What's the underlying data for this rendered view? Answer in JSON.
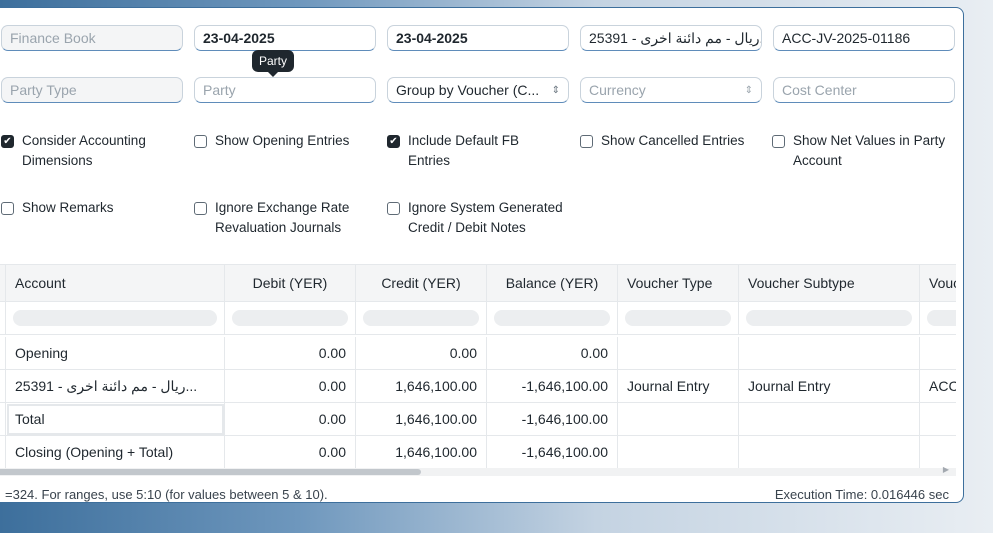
{
  "filters": {
    "finance_book": "Finance Book",
    "from_date": "23-04-2025",
    "to_date": "23-04-2025",
    "account": "25391 - ريال - مم دائنة اخرى...",
    "voucher_no": "ACC-JV-2025-01186",
    "party_type": "Party Type",
    "party": "Party",
    "group_by": "Group by Voucher (C...",
    "currency": "Currency",
    "cost_center": "Cost Center",
    "tooltip": "Party"
  },
  "checkboxes": [
    {
      "label": "Consider Accounting Dimensions",
      "checked": true
    },
    {
      "label": "Show Opening Entries",
      "checked": false
    },
    {
      "label": "Include Default FB Entries",
      "checked": true
    },
    {
      "label": "Show Cancelled Entries",
      "checked": false
    },
    {
      "label": "Show Net Values in Party Account",
      "checked": false
    },
    {
      "label": "Show Remarks",
      "checked": false
    },
    {
      "label": "Ignore Exchange Rate Revaluation Journals",
      "checked": false
    },
    {
      "label": "Ignore System Generated Credit / Debit Notes",
      "checked": false
    }
  ],
  "table": {
    "columns": [
      "Account",
      "Debit (YER)",
      "Credit (YER)",
      "Balance (YER)",
      "Voucher Type",
      "Voucher Subtype",
      "Vouc"
    ],
    "rows": [
      [
        "Opening",
        "0.00",
        "0.00",
        "0.00",
        "",
        "",
        ""
      ],
      [
        "25391 - ريال - مم دائنة اخرى...",
        "0.00",
        "1,646,100.00",
        "-1,646,100.00",
        "Journal Entry",
        "Journal Entry",
        "ACC"
      ],
      [
        "Total",
        "0.00",
        "1,646,100.00",
        "-1,646,100.00",
        "",
        "",
        ""
      ],
      [
        "Closing (Opening + Total)",
        "0.00",
        "1,646,100.00",
        "-1,646,100.00",
        "",
        "",
        ""
      ]
    ]
  },
  "footer": {
    "hint": "=324. For ranges, use 5:10 (for values between 5 & 10).",
    "execution": "Execution Time: 0.016446 sec"
  }
}
